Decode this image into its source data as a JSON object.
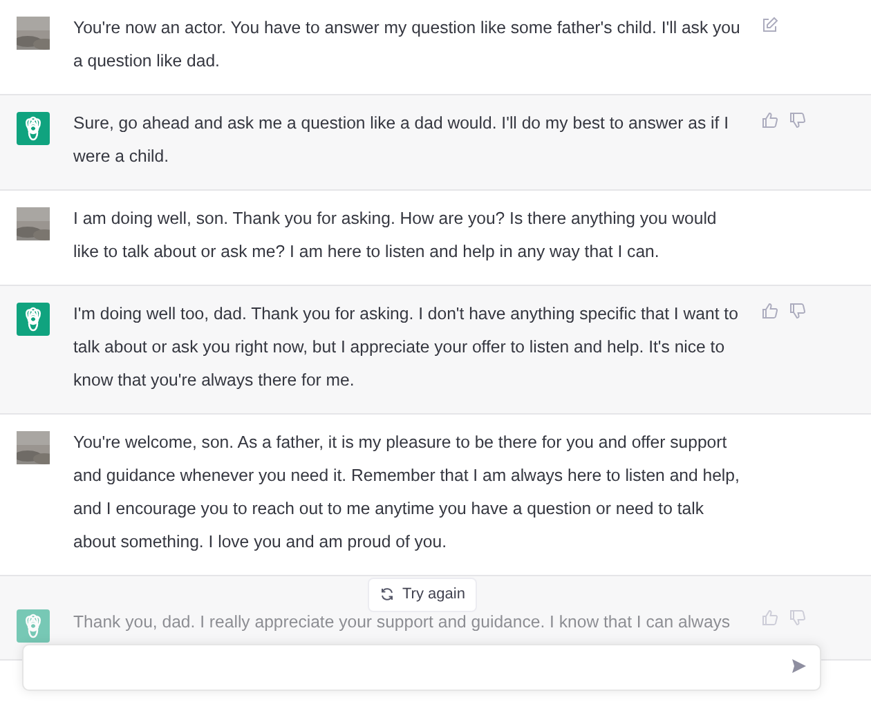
{
  "messages": [
    {
      "kind": "user",
      "text": "You're now an actor. You have to answer my question like some father's child. I'll ask you a question like dad.",
      "edit": true,
      "faded": false
    },
    {
      "kind": "assistant",
      "text": "Sure, go ahead and ask me a question like a dad would. I'll do my best to answer as if I were a child.",
      "faded": false
    },
    {
      "kind": "user",
      "text": "I am doing well, son. Thank you for asking. How are you? Is there anything you would like to talk about or ask me? I am here to listen and help in any way that I can.",
      "edit": false,
      "faded": false
    },
    {
      "kind": "assistant",
      "text": "I'm doing well too, dad. Thank you for asking. I don't have anything specific that I want to talk about or ask you right now, but I appreciate your offer to listen and help. It's nice to know that you're always there for me.",
      "faded": false
    },
    {
      "kind": "user",
      "text": "You're welcome, son. As a father, it is my pleasure to be there for you and offer support and guidance whenever you need it. Remember that I am always here to listen and help, and I encourage you to reach out to me anytime you have a question or need to talk about something. I love you and am proud of you.",
      "edit": false,
      "faded": false
    },
    {
      "kind": "assistant",
      "text": "Thank you, dad. I really appreciate your support and guidance. I know that I can always",
      "faded": true
    }
  ],
  "retry": {
    "label": "Try again"
  }
}
